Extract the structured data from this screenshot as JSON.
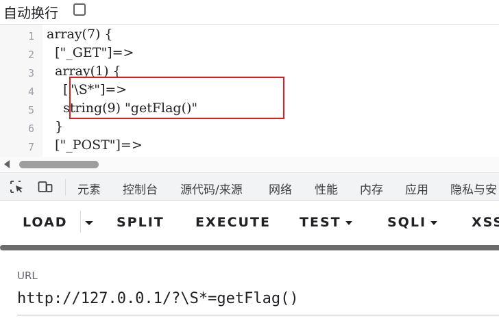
{
  "wrap": {
    "label": "自动换行",
    "checked": false
  },
  "code_lines": [
    {
      "num": "1",
      "text": "array(7) {"
    },
    {
      "num": "2",
      "text": "  [\"_GET\"]=>"
    },
    {
      "num": "3",
      "text": "  array(1) {"
    },
    {
      "num": "4",
      "text": "    [\"\\S*\"]=>"
    },
    {
      "num": "5",
      "text": "    string(9) \"getFlag()\""
    },
    {
      "num": "6",
      "text": "  }"
    },
    {
      "num": "7",
      "text": "  [\"_POST\"]=>"
    }
  ],
  "devtools": {
    "icons": [
      "inspect-element-icon",
      "device-toolbar-icon"
    ],
    "tabs": [
      "元素",
      "控制台",
      "源代码/来源",
      "网络",
      "性能",
      "内存",
      "应用",
      "隐私与安"
    ]
  },
  "hackbar": {
    "load": "LOAD",
    "split": "SPLIT",
    "execute": "EXECUTE",
    "test": "TEST",
    "sqli": "SQLI",
    "xss": "XSS"
  },
  "url": {
    "label": "URL",
    "value": "http://127.0.0.1/?\\S*=getFlag()"
  },
  "colors": {
    "highlight_box": "#e01e1e",
    "scroll_thumb": "#9e9e9e"
  }
}
